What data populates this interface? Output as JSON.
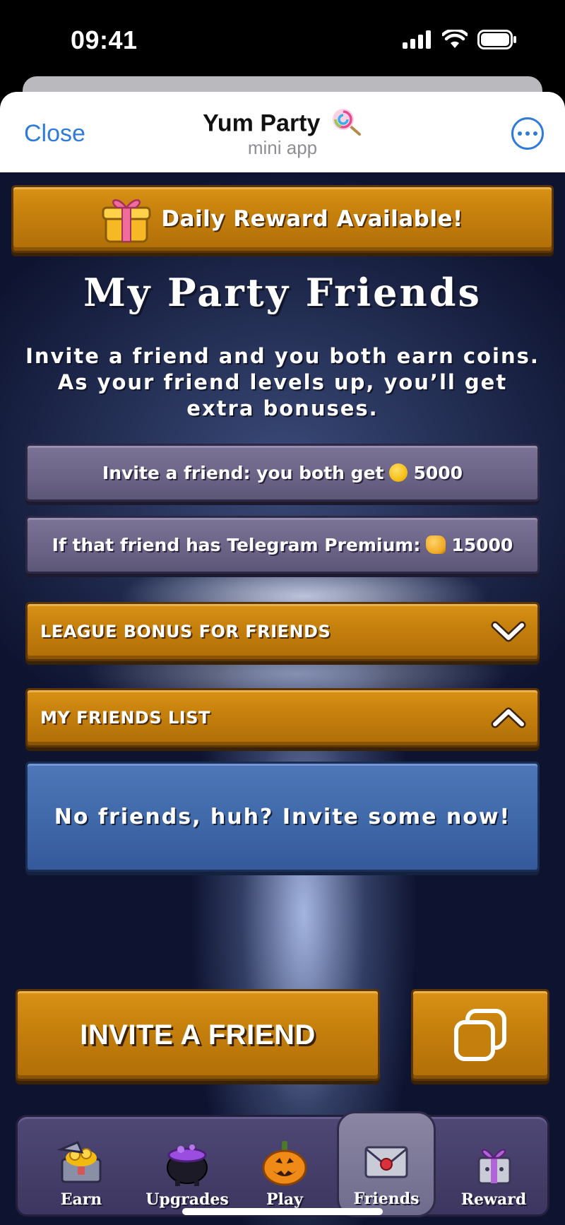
{
  "status_bar": {
    "time": "09:41"
  },
  "telegram_header": {
    "close_label": "Close",
    "title": "Yum Party",
    "subtitle": "mini app",
    "accent_color": "#2f7bd9"
  },
  "daily_reward": {
    "label": "Daily Reward Available!",
    "icon": "gift-icon"
  },
  "page": {
    "title": "My Party Friends",
    "intro": "Invite a friend and you both earn coins. As your friend levels up, you’ll get extra bonuses."
  },
  "info_cards": {
    "invite_text": "Invite a friend: you both get",
    "invite_amount": "5000",
    "premium_text": "If that friend has Telegram Premium:",
    "premium_amount": "15000"
  },
  "accordions": {
    "league_bonus": {
      "label": "LEAGUE BONUS FOR FRIENDS",
      "state": "collapsed"
    },
    "friends_list": {
      "label": "MY FRIENDS LIST",
      "state": "expanded"
    }
  },
  "friends_list": {
    "empty_message": "No friends, huh? Invite some now!"
  },
  "actions": {
    "invite_label": "INVITE A FRIEND",
    "copy_icon": "copy-icon"
  },
  "bottom_nav": {
    "active": "Friends",
    "items": [
      {
        "label": "Earn",
        "icon": "treasure-chest-icon"
      },
      {
        "label": "Upgrades",
        "icon": "cauldron-icon"
      },
      {
        "label": "Play",
        "icon": "pumpkin-icon"
      },
      {
        "label": "Friends",
        "icon": "envelope-icon"
      },
      {
        "label": "Reward",
        "icon": "gift-box-icon"
      }
    ]
  },
  "colors": {
    "wood": "#c47f0c",
    "stone": "#6a6385",
    "blue_panel": "#3e67a8",
    "background": "#1b2446"
  }
}
